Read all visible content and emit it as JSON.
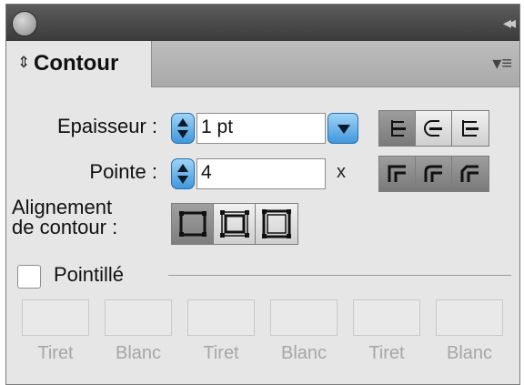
{
  "tab": {
    "label": "Contour",
    "arrows": "⇕"
  },
  "menu_icon": "▾≡",
  "collapse_icon": "◂◂",
  "stroke": {
    "weight_label": "Epaisseur :",
    "weight_value": "1 pt",
    "miter_label": "Pointe :",
    "miter_value": "4",
    "miter_unit": "x",
    "align_label_1": "Alignement",
    "align_label_2": "de contour :"
  },
  "dashed": {
    "label": "Pointillé"
  },
  "dash_labels": [
    "Tiret",
    "Blanc",
    "Tiret",
    "Blanc",
    "Tiret",
    "Blanc"
  ]
}
